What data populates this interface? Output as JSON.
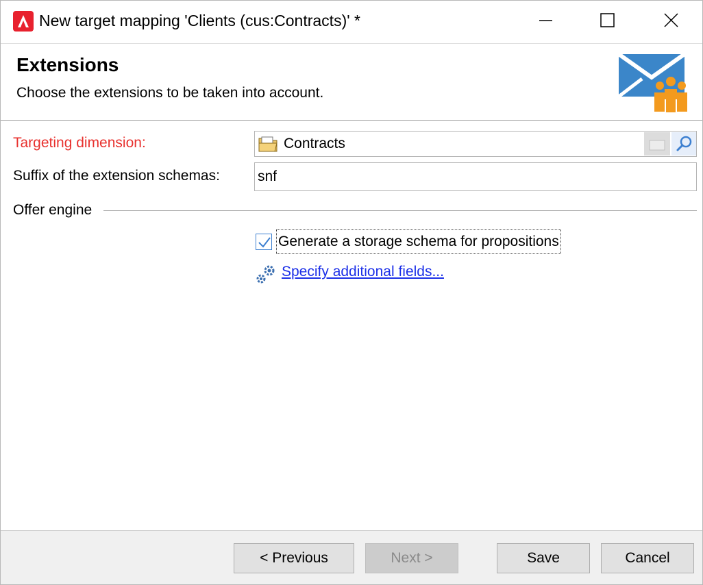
{
  "window": {
    "title": "New target mapping 'Clients (cus:Contracts)' *",
    "app_icon": "adobe-campaign-icon"
  },
  "header": {
    "title": "Extensions",
    "subtitle": "Choose the extensions to be taken into account.",
    "illustration": "envelope-with-people-icon"
  },
  "form": {
    "targeting_dimension": {
      "label": "Targeting dimension:",
      "value": "Contracts",
      "label_color": "#e8312e"
    },
    "suffix": {
      "label": "Suffix of the extension schemas:",
      "value": "snf"
    },
    "offer_engine": {
      "group_label": "Offer engine",
      "checkbox_label": "Generate a storage schema for propositions",
      "checkbox_checked": true,
      "link_text": "Specify additional fields..."
    }
  },
  "footer": {
    "previous": "< Previous",
    "next": "Next >",
    "save": "Save",
    "cancel": "Cancel"
  }
}
